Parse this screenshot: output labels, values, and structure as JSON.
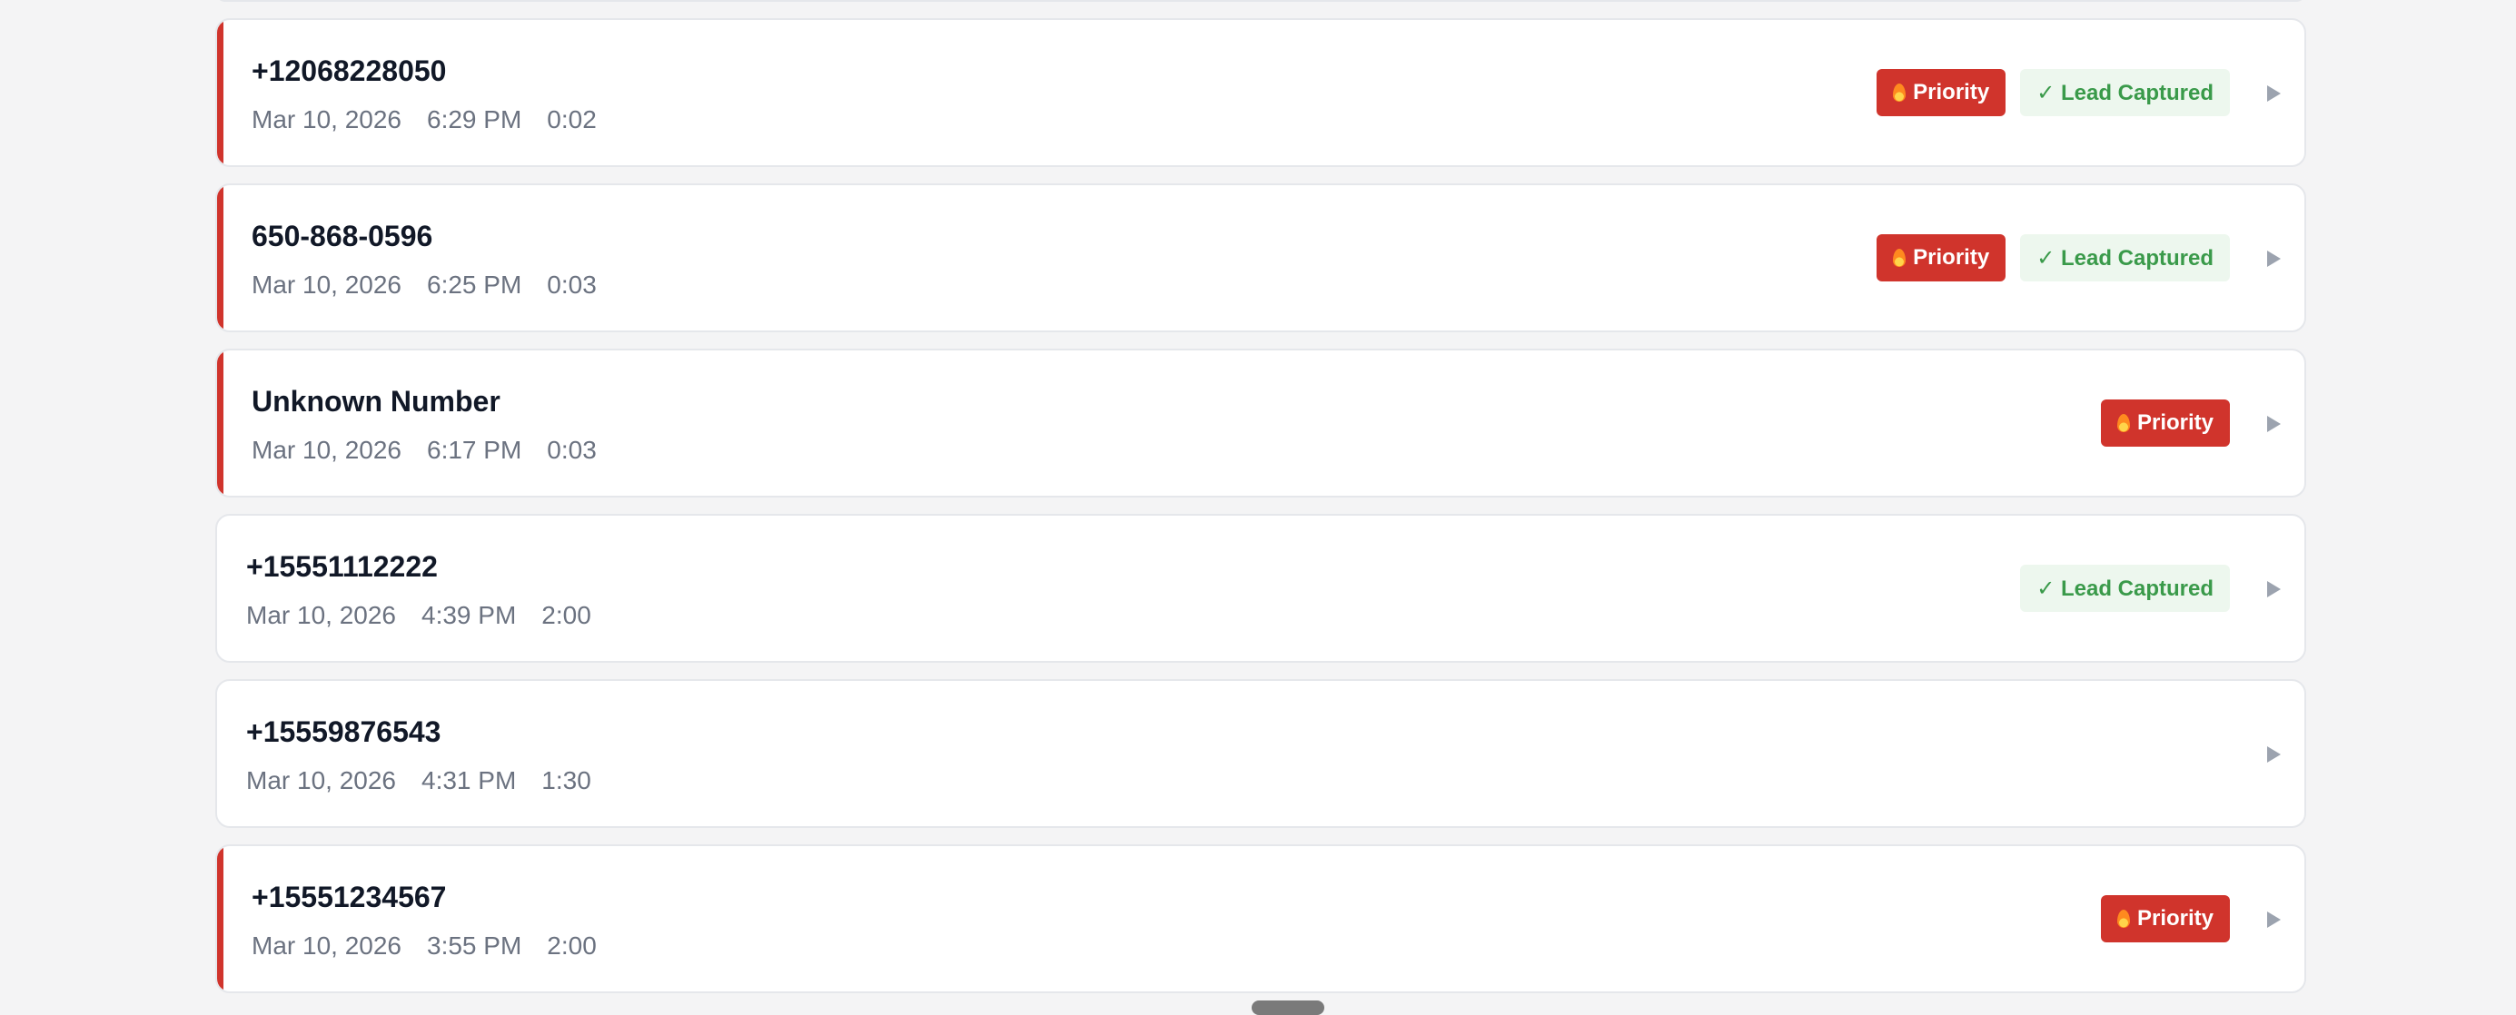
{
  "calls": [
    {
      "caller": "+12068228050",
      "date": "Mar 10, 2026",
      "time": "6:29 PM",
      "duration": "0:02",
      "priority": true,
      "priority_label": "Priority",
      "lead_captured": true,
      "lead_label": "✓ Lead Captured"
    },
    {
      "caller": "650-868-0596",
      "date": "Mar 10, 2026",
      "time": "6:25 PM",
      "duration": "0:03",
      "priority": true,
      "priority_label": "Priority",
      "lead_captured": true,
      "lead_label": "✓ Lead Captured"
    },
    {
      "caller": "Unknown Number",
      "date": "Mar 10, 2026",
      "time": "6:17 PM",
      "duration": "0:03",
      "priority": true,
      "priority_label": "Priority",
      "lead_captured": false
    },
    {
      "caller": "+15551112222",
      "date": "Mar 10, 2026",
      "time": "4:39 PM",
      "duration": "2:00",
      "priority": false,
      "lead_captured": true,
      "lead_label": "✓ Lead Captured"
    },
    {
      "caller": "+15559876543",
      "date": "Mar 10, 2026",
      "time": "4:31 PM",
      "duration": "1:30",
      "priority": false,
      "lead_captured": false
    },
    {
      "caller": "+15551234567",
      "date": "Mar 10, 2026",
      "time": "3:55 PM",
      "duration": "2:00",
      "priority": true,
      "priority_label": "Priority",
      "lead_captured": false
    }
  ],
  "colors": {
    "priority": "#d0342c",
    "lead_captured_text": "#3a9a4a",
    "lead_captured_bg": "#edf7ee",
    "page_bg": "#f4f4f5"
  },
  "icons": {
    "priority": "flame-icon",
    "expand": "play-arrow-icon"
  }
}
